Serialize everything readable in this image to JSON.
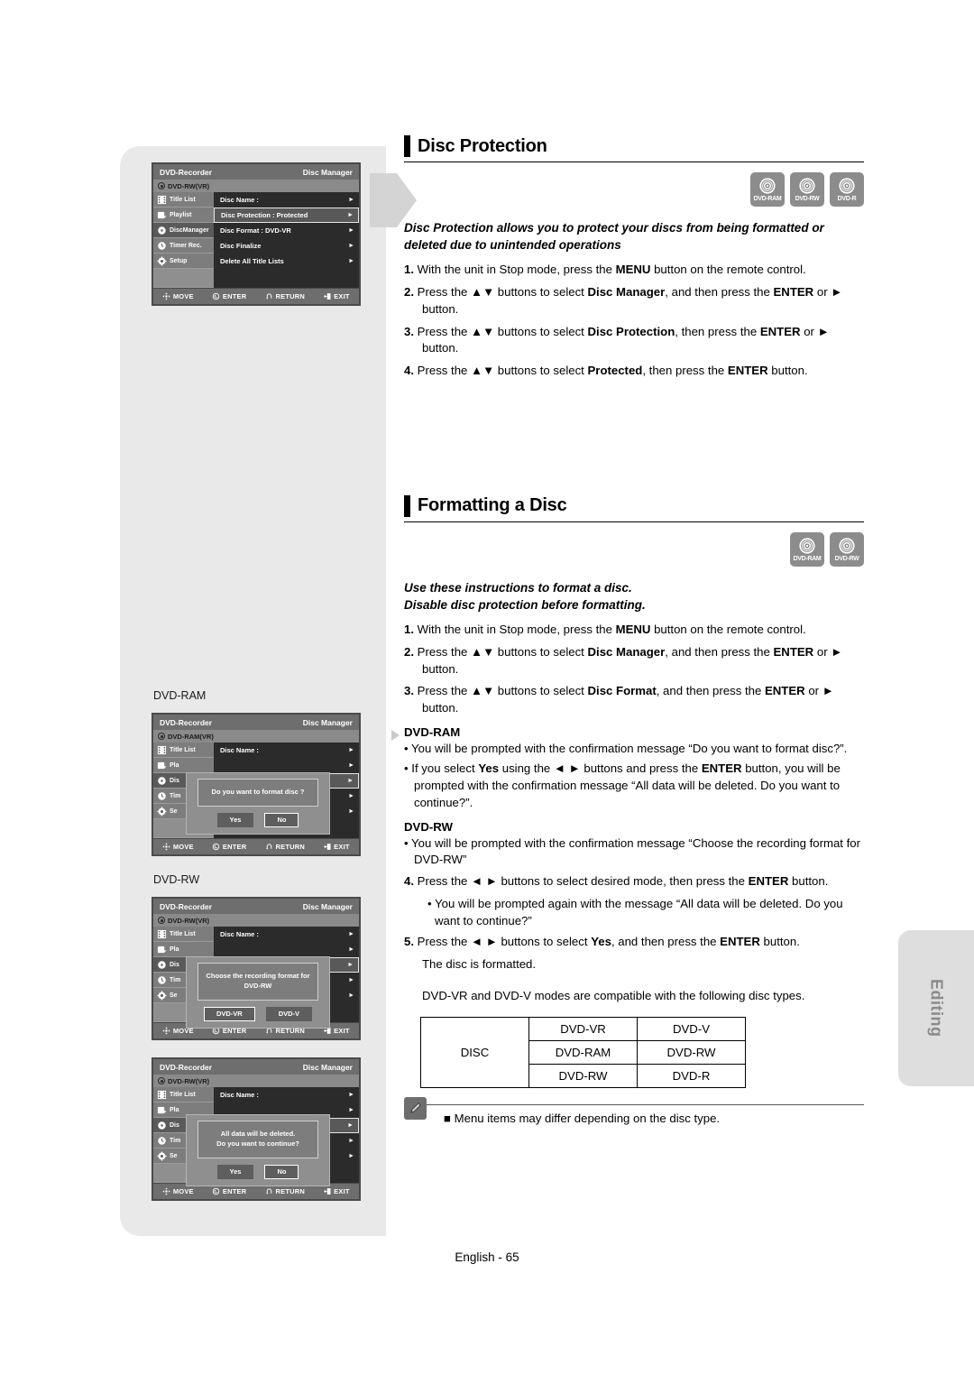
{
  "sections": [
    {
      "title": "Disc Protection",
      "badges": [
        "DVD-RAM",
        "DVD-RW",
        "DVD-R"
      ],
      "lead": "Disc Protection allows you to protect your discs from being formatted or deleted due to unintended operations",
      "steps": [
        {
          "num": "1.",
          "text": "With the unit in Stop mode, press the MENU button on the remote control."
        },
        {
          "num": "2.",
          "text": "Press the ▲▼ buttons to select Disc Manager, and then press the ENTER or ► button."
        },
        {
          "num": "3.",
          "text": "Press the ▲▼ buttons to select Disc Protection, then press the ENTER or ► button."
        },
        {
          "num": "4.",
          "text": "Press the ▲▼ buttons to select Protected, then press the ENTER button."
        }
      ]
    },
    {
      "title": "Formatting a Disc",
      "badges": [
        "DVD-RAM",
        "DVD-RW"
      ],
      "lead_line1": "Use these instructions to format a disc.",
      "lead_line2": "Disable disc protection before formatting.",
      "steps": [
        {
          "num": "1.",
          "text": "With the unit in Stop mode, press the MENU button on the remote control."
        },
        {
          "num": "2.",
          "text": "Press the ▲▼ buttons to select Disc Manager, and then press the ENTER or ► button."
        },
        {
          "num": "3.",
          "text": "Press the ▲▼ buttons to select Disc Format, and then press the ENTER or ► button."
        }
      ],
      "dvd_ram_head": "DVD-RAM",
      "dvd_ram_bullets": [
        "You will be prompted with the confirmation message “Do you want to format disc?”.",
        "If you select Yes using the ◄ ► buttons and press the ENTER button, you will be prompted with the confirmation message “All data will be deleted. Do you want to continue?”."
      ],
      "dvd_rw_head": "DVD-RW",
      "dvd_rw_bullets": [
        "You will be prompted with the confirmation message “Choose the recording format for DVD-RW”"
      ],
      "step4": {
        "num": "4.",
        "text": "Press the ◄ ► buttons to select desired mode, then press the ENTER button."
      },
      "step4_sub": "• You will be prompted again with the message “All data will be deleted. Do you want to continue?”",
      "step5": {
        "num": "5.",
        "text": "Press the ◄ ► buttons to select Yes, and then press the ENTER button."
      },
      "step5_extra": "The disc is formatted.",
      "compat_text": "DVD-VR and DVD-V modes are compatible with the following disc types.",
      "table": {
        "label": "DISC",
        "rows": [
          [
            "DVD-VR",
            "DVD-V"
          ],
          [
            "DVD-RAM",
            "DVD-RW"
          ],
          [
            "DVD-RW",
            "DVD-R"
          ]
        ]
      },
      "note": "■ Menu items may differ depending on the disc type."
    }
  ],
  "osd": {
    "screen1": {
      "brand": "DVD-Recorder",
      "mode": "Disc Manager",
      "disc": "DVD-RW(VR)",
      "sidebar": [
        "Title List",
        "Playlist",
        "DiscManager",
        "Timer Rec.",
        "Setup"
      ],
      "menu": [
        "Disc Name :",
        "Disc Protection : Protected",
        "Disc Format : DVD-VR",
        "Disc Finalize",
        "Delete All Title Lists"
      ],
      "selected_index": 1
    },
    "screen2": {
      "caption": "DVD-RAM",
      "brand": "DVD-Recorder",
      "mode": "Disc Manager",
      "disc": "DVD-RAM(VR)",
      "sidebar": [
        "Title List",
        "Pla",
        "Dis",
        "Tim",
        "Se"
      ],
      "menu_first": "Disc Name          :",
      "dialog_message": "Do you want to format disc ?",
      "buttons": [
        "Yes",
        "No"
      ],
      "focused_button": "No"
    },
    "screen3": {
      "caption": "DVD-RW",
      "brand": "DVD-Recorder",
      "mode": "Disc Manager",
      "disc": "DVD-RW(VR)",
      "sidebar": [
        "Title List",
        "Pla",
        "Dis",
        "Tim",
        "Se"
      ],
      "menu_first": "Disc Name :",
      "dialog_message": "Choose the recording format for DVD-RW",
      "buttons": [
        "DVD-VR",
        "DVD-V"
      ],
      "focused_button": "DVD-VR"
    },
    "screen4": {
      "brand": "DVD-Recorder",
      "mode": "Disc Manager",
      "disc": "DVD-RW(VR)",
      "sidebar": [
        "Title List",
        "Pla",
        "Dis",
        "Tim",
        "Se"
      ],
      "menu_first": "Disc Name :",
      "dialog_message_line1": "All data will be deleted.",
      "dialog_message_line2": "Do you want to continue?",
      "buttons": [
        "Yes",
        "No"
      ],
      "focused_button": "No"
    },
    "footbar": [
      "MOVE",
      "ENTER",
      "RETURN",
      "EXIT"
    ]
  },
  "side_tab": "Editing",
  "footer": "English - 65"
}
